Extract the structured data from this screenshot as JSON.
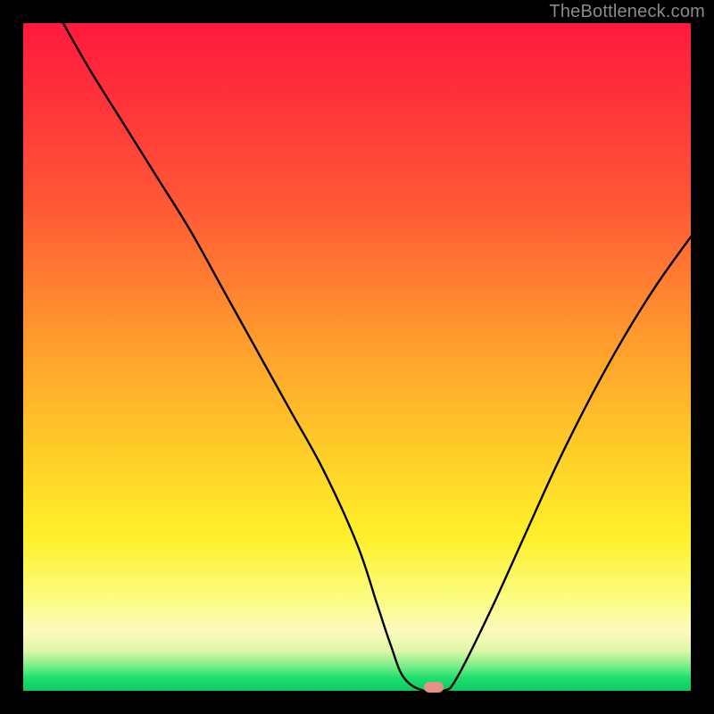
{
  "watermark": "TheBottleneck.com",
  "chart_data": {
    "type": "line",
    "title": "",
    "xlabel": "",
    "ylabel": "",
    "xlim": [
      0,
      100
    ],
    "ylim": [
      0,
      100
    ],
    "grid": false,
    "legend": false,
    "series": [
      {
        "name": "bottleneck-curve",
        "x": [
          6,
          10,
          15,
          20,
          25,
          30,
          35,
          40,
          45,
          50,
          53,
          55,
          57,
          60,
          63,
          65,
          70,
          75,
          80,
          85,
          90,
          95,
          100
        ],
        "y": [
          100,
          93,
          85,
          77,
          69,
          60,
          51,
          42,
          33,
          22,
          13,
          7,
          2,
          0,
          0,
          2,
          12,
          23,
          34,
          44,
          53,
          61,
          68
        ]
      }
    ],
    "marker": {
      "x": 61.5,
      "y": 0.5,
      "color": "#e79184"
    },
    "background_gradient": {
      "stops": [
        {
          "pos": 0.0,
          "color": "#ff1a3d"
        },
        {
          "pos": 0.28,
          "color": "#ff5a36"
        },
        {
          "pos": 0.47,
          "color": "#ff9a2d"
        },
        {
          "pos": 0.65,
          "color": "#ffd028"
        },
        {
          "pos": 0.86,
          "color": "#fcfc80"
        },
        {
          "pos": 0.94,
          "color": "#dff7a8"
        },
        {
          "pos": 1.0,
          "color": "#0dc963"
        }
      ]
    }
  }
}
